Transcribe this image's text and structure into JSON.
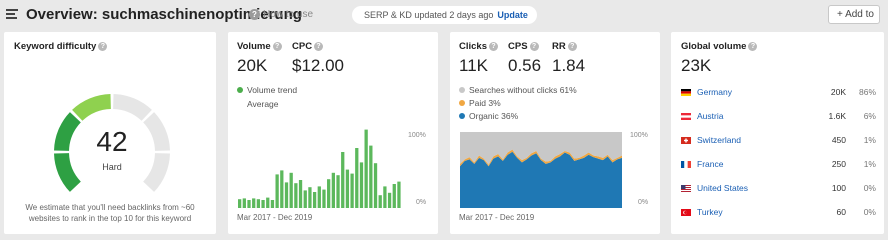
{
  "header": {
    "title": "Overview: suchmaschinenoptimierung",
    "how_to": "How to use",
    "update_status": "SERP & KD updated 2 days ago",
    "update_link": "Update",
    "add_to": "+ Add to",
    "help_icon": "question-icon"
  },
  "kd": {
    "label": "Keyword difficulty",
    "value": "42",
    "level": "Hard",
    "score": 42,
    "note": "We estimate that you'll need backlinks from ~60 websites to rank in the top 10 for this keyword",
    "colors": {
      "filled_dark": "#2ea043",
      "filled_light": "#8fd14f",
      "empty": "#e6e6e6"
    }
  },
  "volume": {
    "label": "Volume",
    "value": "20K",
    "cpc_label": "CPC",
    "cpc_value": "$12.00",
    "legend_trend": "Volume trend",
    "legend_avg": "Average",
    "trend_color": "#5cb85c",
    "axis_top": "100%",
    "axis_bottom": "0%",
    "range": "Mar 2017 - Dec 2019"
  },
  "clicks": {
    "label": "Clicks",
    "value": "11K",
    "cps_label": "CPS",
    "cps_value": "0.56",
    "rr_label": "RR",
    "rr_value": "1.84",
    "legend": [
      {
        "label": "Searches without clicks 61%",
        "color": "#c8c8c8"
      },
      {
        "label": "Paid 3%",
        "color": "#f0a742"
      },
      {
        "label": "Organic 36%",
        "color": "#1f78b4"
      }
    ],
    "axis_top": "100%",
    "axis_bottom": "0%",
    "range": "Mar 2017 - Dec 2019"
  },
  "global": {
    "label": "Global volume",
    "value": "23K",
    "countries": [
      {
        "name": "Germany",
        "volume": "20K",
        "pct": "86%",
        "flag": "germany"
      },
      {
        "name": "Austria",
        "volume": "1.6K",
        "pct": "6%",
        "flag": "austria"
      },
      {
        "name": "Switzerland",
        "volume": "450",
        "pct": "1%",
        "flag": "switzerland"
      },
      {
        "name": "France",
        "volume": "250",
        "pct": "1%",
        "flag": "france"
      },
      {
        "name": "United States",
        "volume": "100",
        "pct": "0%",
        "flag": "united-states"
      },
      {
        "name": "Turkey",
        "volume": "60",
        "pct": "0%",
        "flag": "turkey"
      }
    ]
  },
  "chart_data": [
    {
      "type": "bar",
      "series": [
        {
          "values": [
            0.11,
            0.12,
            0.1,
            0.12,
            0.11,
            0.1,
            0.13,
            0.1,
            0.42,
            0.47,
            0.32,
            0.44,
            0.31,
            0.35,
            0.22,
            0.26,
            0.2,
            0.27,
            0.23,
            0.36,
            0.44,
            0.41,
            0.7,
            0.48,
            0.43,
            0.75,
            0.57,
            0.98,
            0.78,
            0.56,
            0.16,
            0.27,
            0.19,
            0.3,
            0.33
          ]
        }
      ],
      "ylim": [
        0,
        1
      ]
    },
    {
      "type": "area",
      "series": [
        {
          "name": "Organic 36%",
          "values": [
            0.55,
            0.62,
            0.64,
            0.58,
            0.66,
            0.63,
            0.55,
            0.65,
            0.68,
            0.62,
            0.7,
            0.74,
            0.66,
            0.6,
            0.64,
            0.69,
            0.72,
            0.63,
            0.58,
            0.6,
            0.65,
            0.68,
            0.73,
            0.7,
            0.62,
            0.64,
            0.66,
            0.7,
            0.67,
            0.65,
            0.63,
            0.68,
            0.6,
            0.64,
            0.66
          ]
        },
        {
          "name": "Paid 3%",
          "values": [
            0.03,
            0.02,
            0.03,
            0.02,
            0.03,
            0.02,
            0.02,
            0.03,
            0.03,
            0.02,
            0.03,
            0.03,
            0.02,
            0.03,
            0.02,
            0.03,
            0.03,
            0.02,
            0.03,
            0.02,
            0.03,
            0.03,
            0.02,
            0.03,
            0.03,
            0.02,
            0.03,
            0.03,
            0.02,
            0.03,
            0.03,
            0.02,
            0.03,
            0.02,
            0.03
          ]
        },
        {
          "name": "Searches without clicks 61%",
          "values": [
            0.42,
            0.36,
            0.33,
            0.4,
            0.31,
            0.35,
            0.43,
            0.32,
            0.29,
            0.36,
            0.27,
            0.23,
            0.32,
            0.37,
            0.34,
            0.28,
            0.25,
            0.35,
            0.39,
            0.38,
            0.32,
            0.29,
            0.25,
            0.27,
            0.35,
            0.34,
            0.31,
            0.27,
            0.31,
            0.32,
            0.34,
            0.3,
            0.37,
            0.34,
            0.31
          ]
        }
      ],
      "ylim": [
        0,
        1
      ]
    }
  ]
}
